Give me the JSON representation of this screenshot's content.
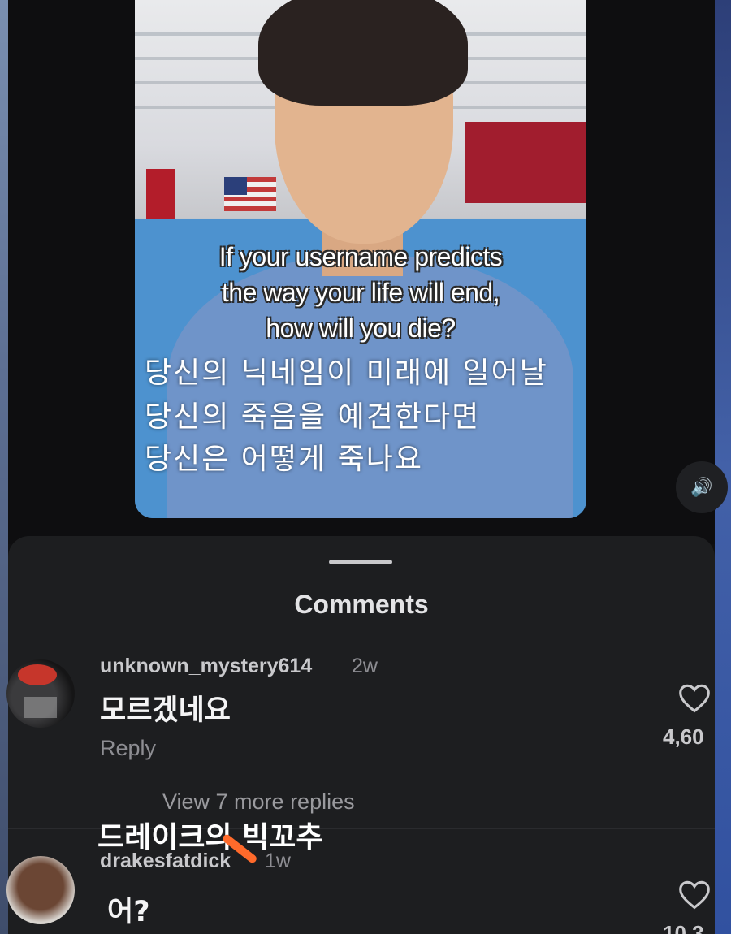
{
  "video": {
    "caption_en": [
      "If your username predicts",
      "the way your life will end,",
      "how will you die?"
    ],
    "caption_ko": [
      "당신의 닉네임이 미래에 일어날",
      "당신의 죽음을 예견한다면",
      "당신은 어떻게 죽나요"
    ],
    "sound_icon": "speaker-icon"
  },
  "sheet": {
    "title": "Comments"
  },
  "comments": [
    {
      "username": "unknown_mystery614",
      "time": "2w",
      "text": "모르겠네요",
      "reply_label": "Reply",
      "likes": "4,60",
      "view_more": "View 7 more replies"
    },
    {
      "username": "drakesfatdick",
      "time": "1w",
      "text": "어?",
      "likes": "10.3",
      "overlay_text": "드레이크의 빅꼬추"
    }
  ],
  "colors": {
    "background": "#101012",
    "sheet": "#1d1e20",
    "text_primary": "#f4f4f5",
    "text_secondary": "#8e8e93"
  }
}
